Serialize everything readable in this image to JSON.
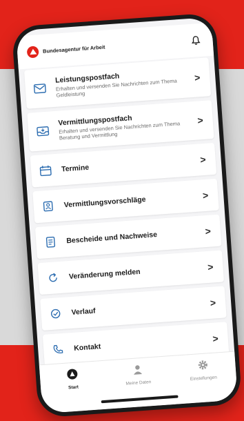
{
  "header": {
    "agency": "Bundesagentur für Arbeit"
  },
  "menu": [
    {
      "title": "Leistungspostfach",
      "subtitle": "Erhalten und versenden Sie Nachrichten zum Thema Geldleistung"
    },
    {
      "title": "Vermittlungspostfach",
      "subtitle": "Erhalten und versenden Sie Nachrichten zum Thema Beratung und Vermittlung"
    },
    {
      "title": "Termine"
    },
    {
      "title": "Vermittlungsvorschläge"
    },
    {
      "title": "Bescheide und Nachweise"
    },
    {
      "title": "Veränderung melden"
    },
    {
      "title": "Verlauf"
    },
    {
      "title": "Kontakt"
    }
  ],
  "tabs": {
    "start": "Start",
    "daten": "Meine Daten",
    "settings": "Einstellungen"
  },
  "colors": {
    "accent": "#e2231a",
    "icon": "#2b6cb0"
  },
  "icons": [
    "logo-icon",
    "bell-icon",
    "chevron-right-icon",
    "home-icon",
    "person-icon",
    "gear-icon"
  ]
}
